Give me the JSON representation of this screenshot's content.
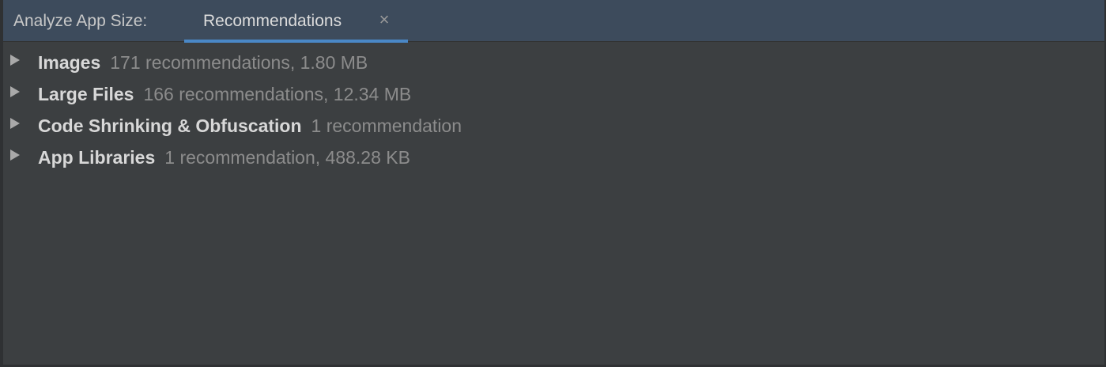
{
  "header": {
    "title": "Analyze App Size:",
    "tab": {
      "label": "Recommendations",
      "close_glyph": "×"
    }
  },
  "tree": {
    "items": [
      {
        "name": "Images",
        "detail": "171 recommendations, 1.80 MB"
      },
      {
        "name": "Large Files",
        "detail": "166 recommendations, 12.34 MB"
      },
      {
        "name": "Code Shrinking & Obfuscation",
        "detail": "1 recommendation"
      },
      {
        "name": "App Libraries",
        "detail": "1 recommendation, 488.28 KB"
      }
    ]
  },
  "colors": {
    "background": "#3c3f41",
    "header_background": "#3d4b5c",
    "tab_underline": "#4a88c7",
    "item_name": "#d8d8d8",
    "item_detail": "#8c8c8c"
  }
}
